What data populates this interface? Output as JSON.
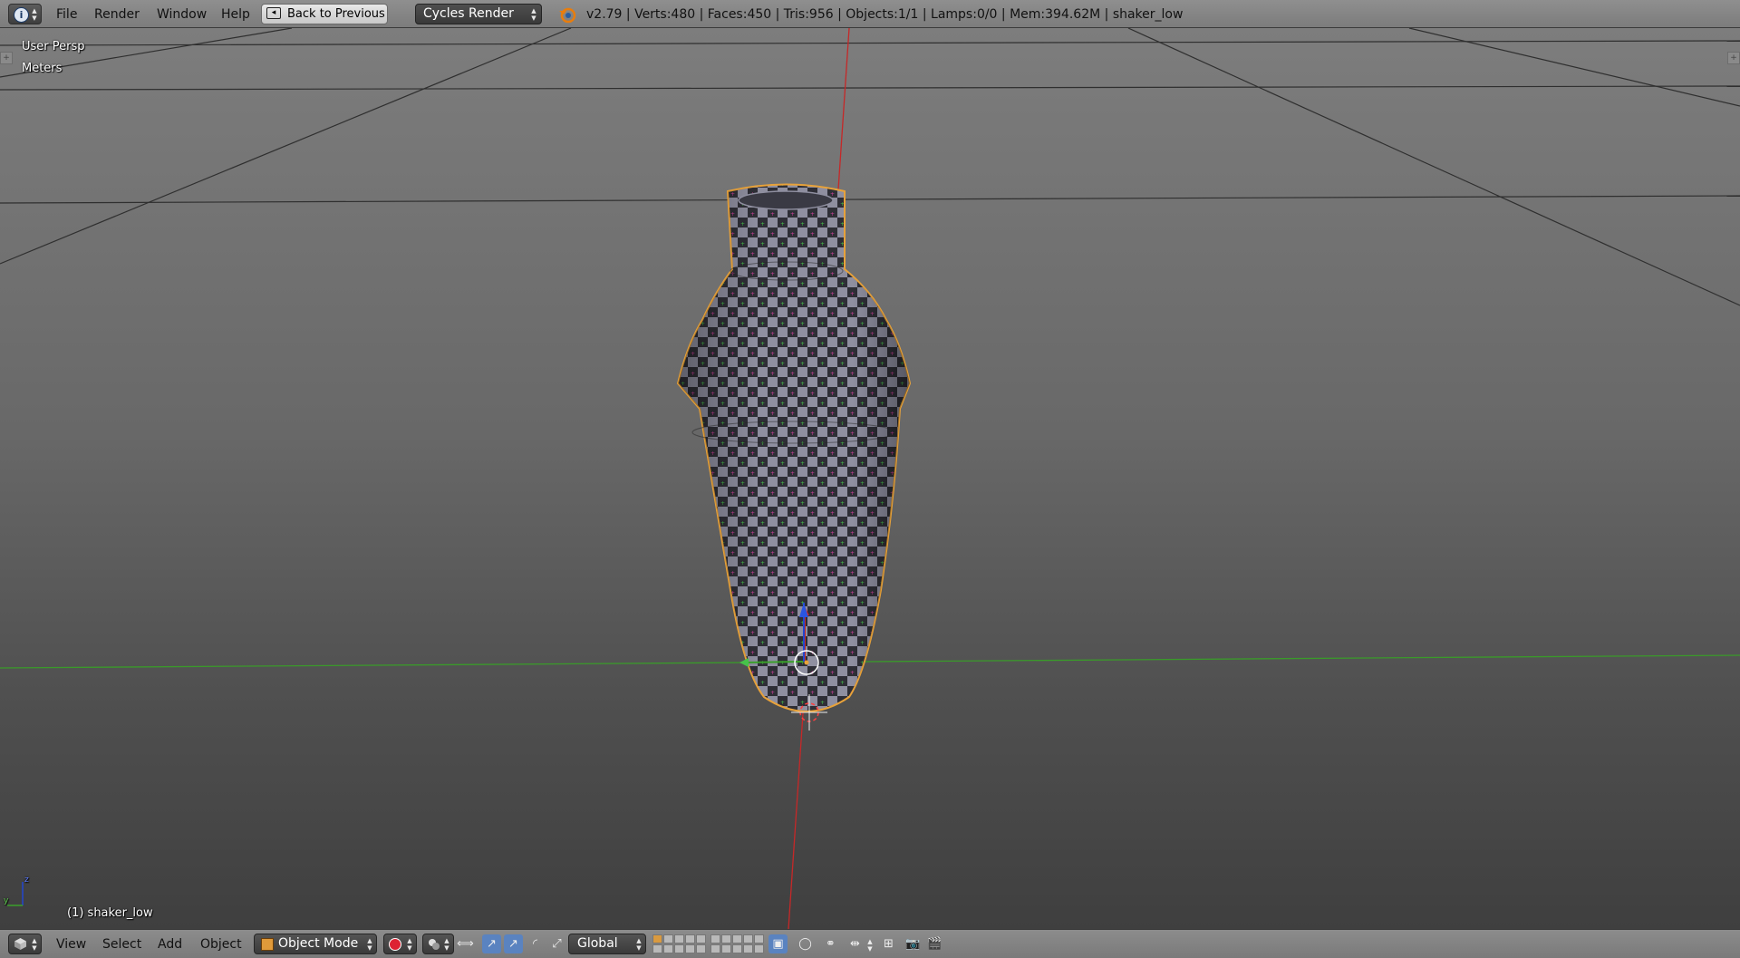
{
  "info_header": {
    "editor_icon": "info-icon",
    "menus": [
      "File",
      "Render",
      "Window",
      "Help"
    ],
    "back_button": "Back to Previous",
    "render_engine": "Cycles Render",
    "stats": "v2.79 | Verts:480 | Faces:450 | Tris:956 | Objects:1/1 | Lamps:0/0 | Mem:394.62M | shaker_low"
  },
  "viewport": {
    "view_name": "User Persp",
    "units": "Meters",
    "object_label": "(1) shaker_low",
    "axis_z": "z",
    "axis_y": "y"
  },
  "view3d_header": {
    "editor_icon": "cube-icon",
    "menus": [
      "View",
      "Select",
      "Add",
      "Object"
    ],
    "mode": "Object Mode",
    "orientation": "Global"
  },
  "colors": {
    "accent_blue": "#5a83c0",
    "selection_orange": "#e8a23a",
    "x_axis_red": "#c62828",
    "y_axis_green": "#3a9a2a"
  }
}
